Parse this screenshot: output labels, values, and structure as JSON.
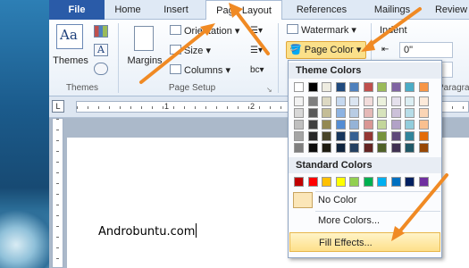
{
  "tabs": [
    "File",
    "Home",
    "Insert",
    "Page Layout",
    "References",
    "Mailings",
    "Review"
  ],
  "groups": {
    "themes": {
      "button": "Themes",
      "label": "Themes"
    },
    "page_setup": {
      "margins": "Margins",
      "orientation": "Orientation",
      "size": "Size",
      "columns": "Columns",
      "label": "Page Setup"
    },
    "background": {
      "watermark": "Watermark",
      "page_color": "Page Color"
    },
    "paragraph": {
      "indent": "Indent",
      "indent_value": "0\"",
      "label": "Paragra"
    }
  },
  "ruler": {
    "numbers": [
      "1",
      "2",
      "3"
    ]
  },
  "document": {
    "text": "Androbuntu.com"
  },
  "dropdown": {
    "theme_colors_title": "Theme Colors",
    "standard_colors_title": "Standard Colors",
    "no_color": "No Color",
    "more_colors": "More Colors...",
    "fill_effects": "Fill Effects...",
    "theme_top_row": [
      "#ffffff",
      "#000000",
      "#eeece1",
      "#1f497d",
      "#4f81bd",
      "#c0504d",
      "#9bbb59",
      "#8064a2",
      "#4bacc6",
      "#f79646"
    ],
    "theme_shades": [
      [
        "#f2f2f2",
        "#7f7f7f",
        "#ddd9c3",
        "#c6d9f0",
        "#dbe5f1",
        "#f2dcdb",
        "#ebf1dd",
        "#e5e0ec",
        "#dbeef3",
        "#fdeada"
      ],
      [
        "#d8d8d8",
        "#595959",
        "#c4bd97",
        "#8db3e2",
        "#b8cce4",
        "#e5b9b7",
        "#d7e3bc",
        "#ccc1d9",
        "#b7dde8",
        "#fbd5b5"
      ],
      [
        "#bfbfbf",
        "#3f3f3f",
        "#938953",
        "#548dd4",
        "#95b3d7",
        "#d99694",
        "#c3d69b",
        "#b2a2c7",
        "#92cddc",
        "#fac08f"
      ],
      [
        "#a5a5a5",
        "#262626",
        "#494429",
        "#17365d",
        "#366092",
        "#953734",
        "#76923c",
        "#5f497a",
        "#31859b",
        "#e36c09"
      ],
      [
        "#7f7f7f",
        "#0c0c0c",
        "#1d1b10",
        "#0f243e",
        "#244061",
        "#632423",
        "#4f6128",
        "#3f3151",
        "#205867",
        "#974806"
      ]
    ],
    "standard": [
      "#c00000",
      "#ff0000",
      "#ffc000",
      "#ffff00",
      "#92d050",
      "#00b050",
      "#00b0f0",
      "#0070c0",
      "#002060",
      "#7030a0"
    ]
  },
  "accent": "#f08a24"
}
